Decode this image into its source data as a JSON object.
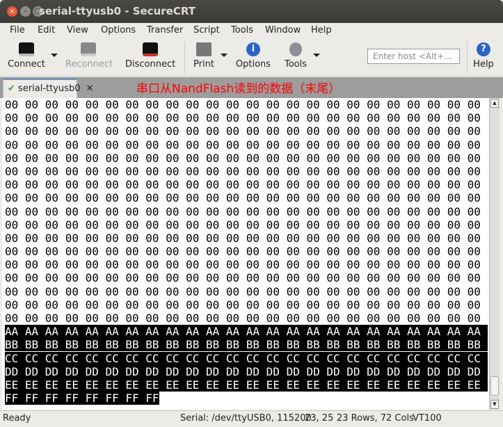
{
  "window": {
    "title": "serial-ttyusb0 - SecureCRT"
  },
  "menu": [
    "File",
    "Edit",
    "View",
    "Options",
    "Transfer",
    "Script",
    "Tools",
    "Window",
    "Help"
  ],
  "toolbar": {
    "connect": "Connect",
    "reconnect": "Reconnect",
    "disconnect": "Disconnect",
    "print": "Print",
    "options": "Options",
    "tools": "Tools",
    "help": "Help",
    "host_placeholder": "Enter host <Alt+..."
  },
  "tab": {
    "label": "serial-ttyusb0",
    "annotation": "串口从NandFlash读到的数据（末尾）"
  },
  "terminal": {
    "lines": [
      "00 00 00 00 00 00 00 00 00 00 00 00 00 00 00 00 00 00 00 00 00 00 00 00",
      "00 00 00 00 00 00 00 00 00 00 00 00 00 00 00 00 00 00 00 00 00 00 00 00",
      "00 00 00 00 00 00 00 00 00 00 00 00 00 00 00 00 00 00 00 00 00 00 00 00",
      "00 00 00 00 00 00 00 00 00 00 00 00 00 00 00 00 00 00 00 00 00 00 00 00",
      "00 00 00 00 00 00 00 00 00 00 00 00 00 00 00 00 00 00 00 00 00 00 00 00",
      "00 00 00 00 00 00 00 00 00 00 00 00 00 00 00 00 00 00 00 00 00 00 00 00",
      "00 00 00 00 00 00 00 00 00 00 00 00 00 00 00 00 00 00 00 00 00 00 00 00",
      "00 00 00 00 00 00 00 00 00 00 00 00 00 00 00 00 00 00 00 00 00 00 00 00",
      "00 00 00 00 00 00 00 00 00 00 00 00 00 00 00 00 00 00 00 00 00 00 00 00",
      "00 00 00 00 00 00 00 00 00 00 00 00 00 00 00 00 00 00 00 00 00 00 00 00",
      "00 00 00 00 00 00 00 00 00 00 00 00 00 00 00 00 00 00 00 00 00 00 00 00",
      "00 00 00 00 00 00 00 00 00 00 00 00 00 00 00 00 00 00 00 00 00 00 00 00",
      "00 00 00 00 00 00 00 00 00 00 00 00 00 00 00 00 00 00 00 00 00 00 00 00",
      "00 00 00 00 00 00 00 00 00 00 00 00 00 00 00 00 00 00 00 00 00 00 00 00",
      "00 00 00 00 00 00 00 00 00 00 00 00 00 00 00 00 00 00 00 00 00 00 00 00",
      "00 00 00 00 00 00 00 00 00 00 00 00 00 00 00 00 00 00 00 00 00 00 00 00",
      "00 00 00 00 00 00 00 00 00 00 00 00 00 00 00 00 00 00 00 00 00 00 00 00"
    ],
    "highlighted_lines": [
      "AA AA AA AA AA AA AA AA AA AA AA AA AA AA AA AA AA AA AA AA AA AA AA AA",
      "BB BB BB BB BB BB BB BB BB BB BB BB BB BB BB BB BB BB BB BB BB BB BB BB",
      "CC CC CC CC CC CC CC CC CC CC CC CC CC CC CC CC CC CC CC CC CC CC CC CC",
      "DD DD DD DD DD DD DD DD DD DD DD DD DD DD DD DD DD DD DD DD DD DD DD DD",
      "EE EE EE EE EE EE EE EE EE EE EE EE EE EE EE EE EE EE EE EE EE EE EE EE",
      "FF FF FF FF FF FF FF FF"
    ]
  },
  "status": {
    "ready": "Ready",
    "connection": "Serial: /dev/ttyUSB0, 115200",
    "cursor": "23, 25",
    "size": "23 Rows, 72 Cols",
    "emulation": "VT100"
  }
}
